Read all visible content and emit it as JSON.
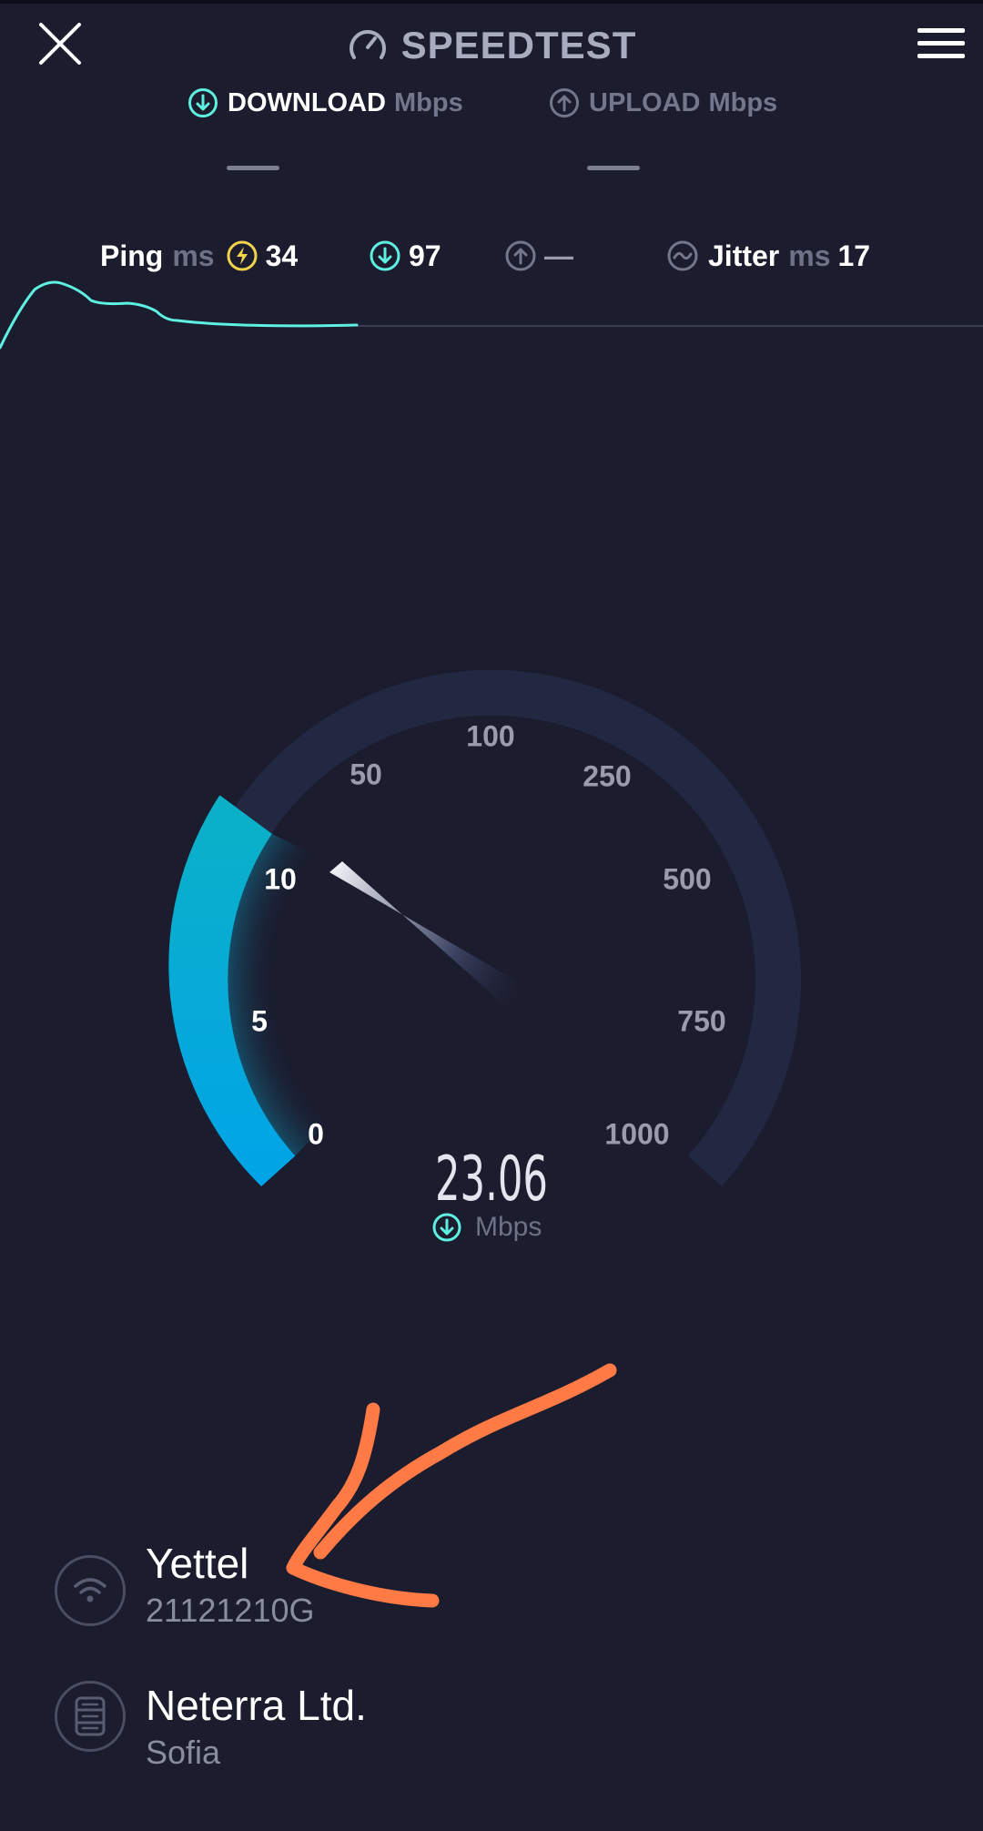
{
  "header": {
    "title": "SPEEDTEST"
  },
  "modes": {
    "download_label": "DOWNLOAD",
    "download_unit": "Mbps",
    "upload_label": "UPLOAD",
    "upload_unit": "Mbps"
  },
  "stats": {
    "ping_label": "Ping",
    "ping_unit": "ms",
    "ping_value": "34",
    "download_value": "97",
    "upload_value": "—",
    "jitter_label": "Jitter",
    "jitter_unit": "ms",
    "jitter_value": "17"
  },
  "gauge": {
    "ticks": [
      "0",
      "5",
      "10",
      "50",
      "100",
      "250",
      "500",
      "750",
      "1000"
    ],
    "active_ticks": [
      "0",
      "5",
      "10"
    ],
    "reading": "23.06",
    "reading_unit": "Mbps"
  },
  "connection": {
    "provider": "Yettel",
    "device": "21121210G"
  },
  "server": {
    "name": "Neterra Ltd.",
    "location": "Sofia"
  },
  "colors": {
    "background": "#1b1c2e",
    "accent_cyan": "#5ef0e0",
    "gauge_fill": "#08a7d8",
    "gauge_track": "#222842",
    "annotation_arrow": "#ff7a45",
    "ping_icon": "#f2d34c"
  },
  "icons": {
    "close": "close-icon",
    "logo": "speedometer-icon",
    "menu": "hamburger-menu-icon",
    "download": "arrow-down-circle-icon",
    "upload": "arrow-up-circle-icon",
    "ping": "ping-bolt-icon",
    "jitter": "jitter-wave-icon",
    "wifi": "wifi-icon",
    "server": "server-icon"
  }
}
